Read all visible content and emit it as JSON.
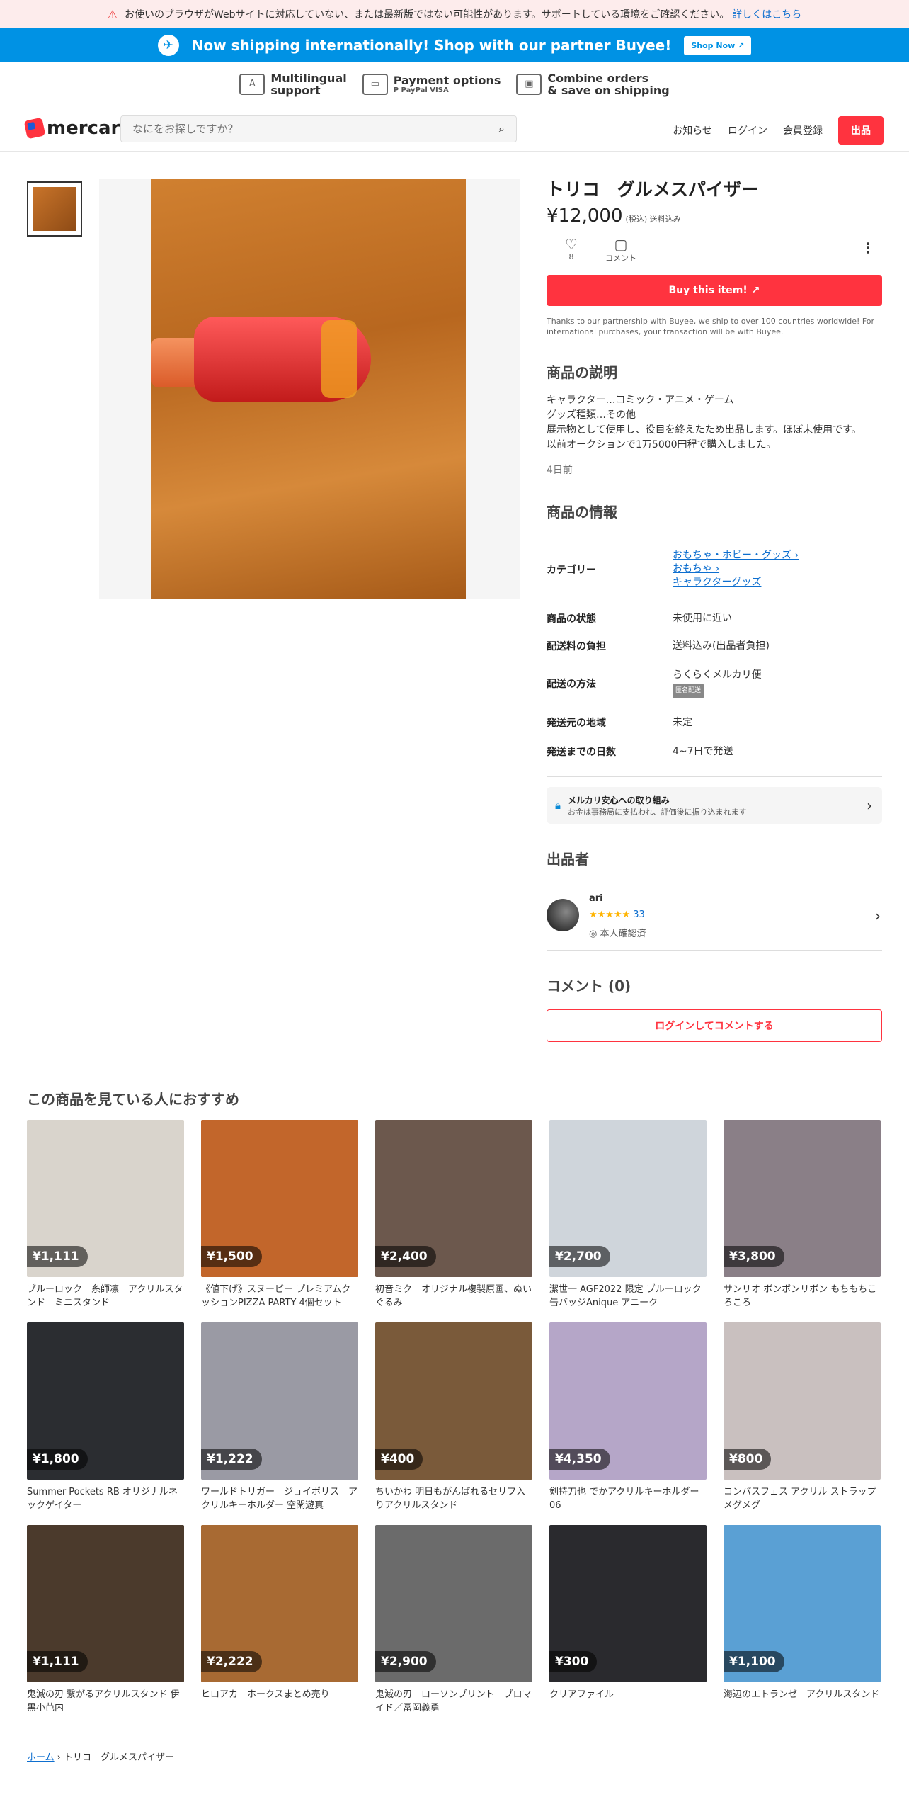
{
  "warning": {
    "text": "お使いのブラウザがWebサイトに対応していない、または最新版ではない可能性があります。サポートしている環境をご確認ください。",
    "link": "詳しくはこちら"
  },
  "banner": {
    "text": "Now shipping internationally! Shop with our partner Buyee!",
    "button": "Shop Now"
  },
  "features": [
    {
      "icon": "language-icon",
      "line1": "Multilingual",
      "line2": "support"
    },
    {
      "icon": "card-icon",
      "line1": "Payment options",
      "line2": "P PayPal VISA"
    },
    {
      "icon": "box-icon",
      "line1": "Combine orders",
      "line2": "& save on shipping"
    }
  ],
  "header": {
    "logo": "mercari",
    "search_placeholder": "なにをお探しですか？",
    "nav": [
      "お知らせ",
      "ログイン",
      "会員登録"
    ],
    "sell": "出品"
  },
  "item": {
    "title": "トリコ　グルメスパイザー",
    "price": "¥12,000",
    "price_note": "(税込) 送料込み",
    "likes": "8",
    "comment_label": "コメント",
    "buy_button": "Buy this item!",
    "buyee_note": "Thanks to our partnership with Buyee, we ship to over 100 countries worldwide! For international purchases, your transaction will be with Buyee.",
    "desc_heading": "商品の説明",
    "description": "キャラクター…コミック・アニメ・ゲーム\nグッズ種類…その他\n展示物として使用し、役目を終えたため出品します。ほぼ未使用です。\n以前オークションで1万5000円程で購入しました。",
    "posted": "4日前",
    "info_heading": "商品の情報",
    "category_label": "カテゴリー",
    "categories": [
      "おもちゃ・ホビー・グッズ",
      "おもちゃ",
      "キャラクターグッズ"
    ],
    "condition_label": "商品の状態",
    "condition": "未使用に近い",
    "shipping_fee_label": "配送料の負担",
    "shipping_fee": "送料込み(出品者負担)",
    "shipping_method_label": "配送の方法",
    "shipping_method": "らくらくメルカリ便",
    "anon_badge": "匿名配送",
    "origin_label": "発送元の地域",
    "origin": "未定",
    "days_label": "発送までの日数",
    "days": "4~7日で発送",
    "safe_title": "メルカリ安心への取り組み",
    "safe_sub": "お金は事務局に支払われ、評価後に振り込まれます",
    "seller_heading": "出品者",
    "seller_name": "ari",
    "seller_stars": "★★★★★",
    "seller_reviews": "33",
    "seller_verified": "本人確認済",
    "comments_heading": "コメント (0)",
    "comment_button": "ログインしてコメントする"
  },
  "recs": {
    "heading": "この商品を見ている人におすすめ",
    "items": [
      {
        "price": "¥1,111",
        "name": "ブルーロック　糸師凛　アクリルスタンド　ミニスタンド",
        "color": "#d9d4cc"
      },
      {
        "price": "¥1,500",
        "name": "《値下げ》スヌーピー プレミアムクッションPIZZA PARTY 4個セット",
        "color": "#c2662b"
      },
      {
        "price": "¥2,400",
        "name": "初音ミク　オリジナル複製原画、ぬいぐるみ",
        "color": "#6c584d"
      },
      {
        "price": "¥2,700",
        "name": "潔世一 AGF2022 限定 ブルーロック 缶バッジAnique アニーク",
        "color": "#cfd5db"
      },
      {
        "price": "¥3,800",
        "name": "サンリオ ボンボンリボン もちもちころころ",
        "color": "#8a7f87"
      },
      {
        "price": "¥1,800",
        "name": "Summer Pockets RB オリジナルネックゲイター",
        "color": "#2b2d31"
      },
      {
        "price": "¥1,222",
        "name": "ワールドトリガー　ジョイポリス　アクリルキーホルダー 空閑遊真",
        "color": "#9a9aa4"
      },
      {
        "price": "¥400",
        "name": "ちいかわ 明日もがんばれるセリフ入りアクリルスタンド",
        "color": "#7a5a3a"
      },
      {
        "price": "¥4,350",
        "name": "剣持刀也 でかアクリルキーホルダー06",
        "color": "#b5a6c8"
      },
      {
        "price": "¥800",
        "name": "コンパスフェス アクリル ストラップ メグメグ",
        "color": "#c9c0bf"
      },
      {
        "price": "¥1,111",
        "name": "鬼滅の刃 繋がるアクリルスタンド 伊黒小芭内",
        "color": "#4b3a2c"
      },
      {
        "price": "¥2,222",
        "name": "ヒロアカ　ホークスまとめ売り",
        "color": "#a86a33"
      },
      {
        "price": "¥2,900",
        "name": "鬼滅の刃　ローソンプリント　ブロマイド／冨岡義勇",
        "color": "#6b6b6b"
      },
      {
        "price": "¥300",
        "name": "クリアファイル",
        "color": "#2a2a2e"
      },
      {
        "price": "¥1,100",
        "name": "海辺のエトランゼ　アクリルスタンド",
        "color": "#5aa0d4"
      }
    ]
  },
  "breadcrumb": {
    "home": "ホーム",
    "current": "トリコ　グルメスパイザー"
  }
}
